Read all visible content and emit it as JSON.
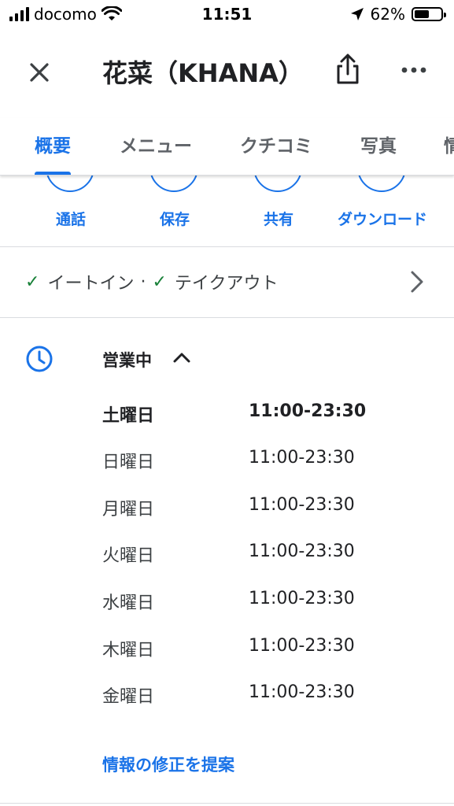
{
  "status_bar": {
    "carrier": "docomo",
    "time": "11:51",
    "battery": "62%",
    "battery_level": 0.62,
    "icons": [
      "signal-icon",
      "wifi-icon",
      "location-arrow-icon",
      "battery-icon"
    ]
  },
  "header": {
    "title": "花菜（KHANA）",
    "icons": [
      "close-icon",
      "share-icon",
      "more-icon"
    ]
  },
  "tabs": [
    {
      "label": "概要",
      "active": true
    },
    {
      "label": "メニュー"
    },
    {
      "label": "クチコミ"
    },
    {
      "label": "写真"
    },
    {
      "label": "情"
    }
  ],
  "actions": [
    {
      "label": "通話",
      "icon": "phone-icon"
    },
    {
      "label": "保存",
      "icon": "bookmark-icon"
    },
    {
      "label": "共有",
      "icon": "share-icon"
    },
    {
      "label": "ダウンロード",
      "icon": "download-icon"
    }
  ],
  "services": {
    "dine_in": "イートイン",
    "separator": "·",
    "takeout": "テイクアウト"
  },
  "hours": {
    "status": "営業中",
    "days": [
      {
        "day": "土曜日",
        "time": "11:00-23:30",
        "today": true
      },
      {
        "day": "日曜日",
        "time": "11:00-23:30"
      },
      {
        "day": "月曜日",
        "time": "11:00-23:30"
      },
      {
        "day": "火曜日",
        "time": "11:00-23:30"
      },
      {
        "day": "水曜日",
        "time": "11:00-23:30"
      },
      {
        "day": "木曜日",
        "time": "11:00-23:30"
      },
      {
        "day": "金曜日",
        "time": "11:00-23:30"
      }
    ],
    "suggest_edit": "情報の修正を提案"
  },
  "colors": {
    "accent": "#1a73e8",
    "check": "#188038",
    "text": "#202124",
    "divider": "#dadce0"
  }
}
